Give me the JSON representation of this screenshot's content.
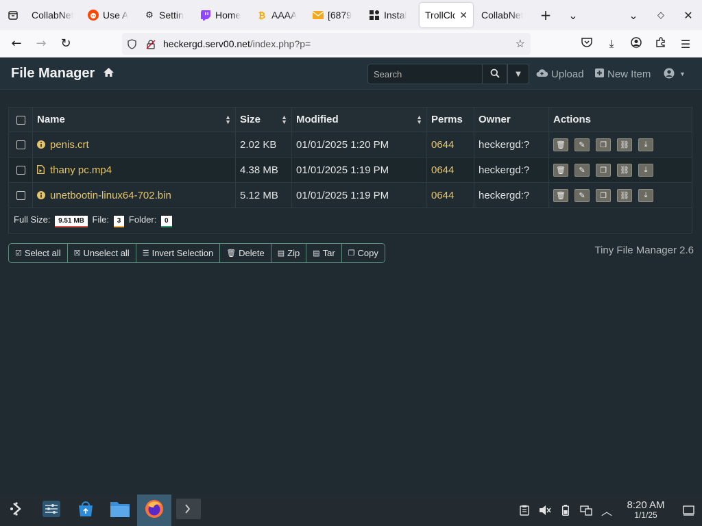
{
  "browser": {
    "tabs": [
      {
        "label": "CollabNet",
        "icon": "none"
      },
      {
        "label": "Use A",
        "icon": "reddit-icon"
      },
      {
        "label": "Settin",
        "icon": "gear-icon"
      },
      {
        "label": "Home",
        "icon": "twitch-icon"
      },
      {
        "label": "AAAA",
        "icon": "bitcoin-icon"
      },
      {
        "label": "[6879",
        "icon": "mail-icon"
      },
      {
        "label": "Instal",
        "icon": "puzzle-icon"
      },
      {
        "label": "TrollClo",
        "icon": "none",
        "active": true
      },
      {
        "label": "CollabNet",
        "icon": "none"
      }
    ],
    "new_tab": "+",
    "url_host": "heckergd.serv00.net",
    "url_path": "/index.php?p="
  },
  "app": {
    "brand": "File Manager",
    "search_placeholder": "Search",
    "upload_label": "Upload",
    "new_item_label": "New Item",
    "columns": {
      "name": "Name",
      "size": "Size",
      "modified": "Modified",
      "perms": "Perms",
      "owner": "Owner",
      "actions": "Actions"
    },
    "files": [
      {
        "name": "penis.crt",
        "icon": "info-icon",
        "size": "2.02 KB",
        "modified": "01/01/2025 1:20 PM",
        "perms": "0644",
        "owner": "heckergd:?"
      },
      {
        "name": "thany pc.mp4",
        "icon": "video-file-icon",
        "size": "4.38 MB",
        "modified": "01/01/2025 1:19 PM",
        "perms": "0644",
        "owner": "heckergd:?"
      },
      {
        "name": "unetbootin-linux64-702.bin",
        "icon": "info-icon",
        "size": "5.12 MB",
        "modified": "01/01/2025 1:19 PM",
        "perms": "0644",
        "owner": "heckergd:?"
      }
    ],
    "summary": {
      "full_size_label": "Full Size:",
      "full_size": "9.51 MB",
      "file_label": "File:",
      "file_count": "3",
      "folder_label": "Folder:",
      "folder_count": "0"
    },
    "bulk_actions": {
      "select_all": "Select all",
      "unselect_all": "Unselect all",
      "invert": "Invert Selection",
      "delete": "Delete",
      "zip": "Zip",
      "tar": "Tar",
      "copy": "Copy"
    },
    "version": "Tiny File Manager 2.6"
  },
  "taskbar": {
    "time": "8:20 AM",
    "date": "1/1/25"
  },
  "colors": {
    "accent_yellow": "#e6c46a",
    "header_bg": "#22313a",
    "content_bg": "#1f2b31",
    "group_border": "#5a8f7d"
  }
}
